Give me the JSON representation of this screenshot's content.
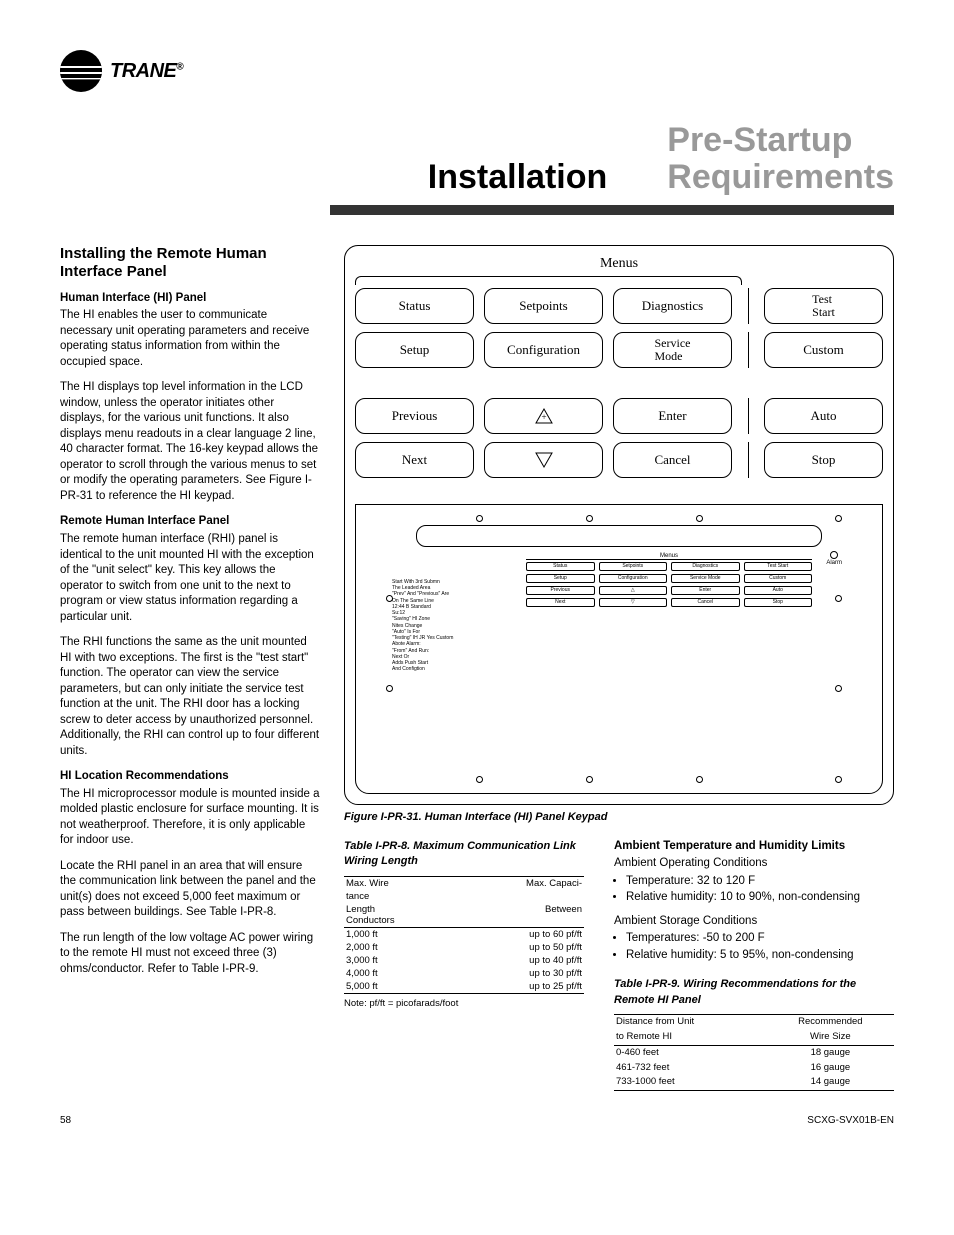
{
  "brand": "TRANE",
  "title_left": "Installation",
  "title_right_l1": "Pre-Startup",
  "title_right_l2": "Requirements",
  "section_h3": "Installing the Remote Human Interface Panel",
  "h4_hi": "Human Interface (HI) Panel",
  "p_hi_1": "The HI enables the user to communicate necessary unit operating parameters and receive operating status information from within the occupied space.",
  "p_hi_2": "The HI displays top level information in the LCD window, unless the operator initiates other displays, for the various unit functions. It also displays menu readouts in a clear language 2 line, 40 character format. The 16-key keypad allows the operator to scroll through the various menus to set or modify the operating parameters. See Figure I-PR-31 to reference the HI keypad.",
  "h4_rhi": "Remote Human Interface Panel",
  "p_rhi_1": "The remote human interface (RHI) panel is identical to the unit mounted HI with the exception of the \"unit select\" key. This key allows the operator to switch from one unit to the next to program or view status information regarding a particular unit.",
  "p_rhi_2": "The RHI functions the same as the unit mounted HI with two exceptions. The first is the \"test start\" function. The operator can view the service parameters, but can only initiate the service test function at the unit. The RHI door has a locking screw to deter access by unauthorized personnel. Additionally, the RHI can control up to four different units.",
  "h4_loc": "HI Location Recommendations",
  "p_loc_1": "The HI microprocessor module is mounted inside a molded plastic enclosure for surface mounting. It is not weatherproof. Therefore, it is only applicable for indoor use.",
  "p_loc_2": "Locate the RHI panel in an area that will ensure the communication link between the panel and the unit(s) does not exceed 5,000 feet maximum or pass between buildings. See Table I-PR-8.",
  "p_loc_3": "The run length of the low voltage AC power wiring to the remote HI must not exceed three (3) ohms/conductor. Refer to Table I-PR-9.",
  "keypad": {
    "menus": "Menus",
    "row1": [
      "Status",
      "Setpoints",
      "Diagnostics",
      "Test Start"
    ],
    "row2": [
      "Setup",
      "Configuration",
      "Service Mode",
      "Custom"
    ],
    "row3": [
      "Previous",
      "+",
      "Enter",
      "Auto"
    ],
    "row4": [
      "Next",
      "−",
      "Cancel",
      "Stop"
    ]
  },
  "panel_small": {
    "alarm": "Alarm",
    "menus": "Menus",
    "rows": [
      [
        "Status",
        "Setpoints",
        "Diagnostics",
        "Test Start"
      ],
      [
        "Setup",
        "Configuration",
        "Service Mode",
        "Custom"
      ],
      [
        "Previous",
        "△",
        "Enter",
        "Auto"
      ],
      [
        "Next",
        "▽",
        "Cancel",
        "Stop"
      ]
    ],
    "side_text": "Start With 3rd Submn\nThe Leaded Area\n\"Prev\" And \"Previous\" Are\nOn The Same Line\n12:44 B Standard\nSu:12\n\"Saving\" HI Zone\nNites Change\n\"Auto\" Is For\n\"Testing\" IH JR Yes Custom\nAbote Alarm:\n\"From\" And Run:\nNext Or\nAdds Push Start\nAnd Configtion"
  },
  "fig_caption": "Figure I-PR-31. Human Interface (HI) Panel Keypad",
  "tbl8": {
    "title": "Table I-PR-8. Maximum Communication Link Wiring Length",
    "h1a": "Max. Wire",
    "h1b": "tance",
    "h2a": "Length",
    "h2b": "Conductors",
    "h_right_a": "Max. Capaci-",
    "h_right_b": "Between",
    "rows": [
      [
        "1,000 ft",
        "up to 60 pf/ft"
      ],
      [
        "2,000 ft",
        "up to 50 pf/ft"
      ],
      [
        "3,000 ft",
        "up to 40 pf/ft"
      ],
      [
        "4,000 ft",
        "up to 30 pf/ft"
      ],
      [
        "5,000 ft",
        "up to 25 pf/ft"
      ]
    ],
    "note": "Note: pf/ft = picofarads/foot"
  },
  "amb": {
    "h": "Ambient Temperature and Humidity Limits",
    "op_h": "Ambient Operating Conditions",
    "op_items": [
      "Temperature: 32 to 120 F",
      "Relative humidity: 10 to 90%, non-condensing"
    ],
    "st_h": "Ambient Storage Conditions",
    "st_items": [
      "Temperatures: -50 to 200 F",
      "Relative humidity: 5 to 95%, non-condensing"
    ]
  },
  "tbl9": {
    "title": "Table I-PR-9. Wiring Recommendations for the Remote HI Panel",
    "h_left_a": "Distance from Unit",
    "h_left_b": "to Remote HI",
    "h_right_a": "Recommended",
    "h_right_b": "Wire Size",
    "rows": [
      [
        "0-460 feet",
        "18 gauge"
      ],
      [
        "461-732 feet",
        "16 gauge"
      ],
      [
        "733-1000 feet",
        "14 gauge"
      ]
    ]
  },
  "footer_left": "58",
  "footer_right": "SCXG-SVX01B-EN"
}
